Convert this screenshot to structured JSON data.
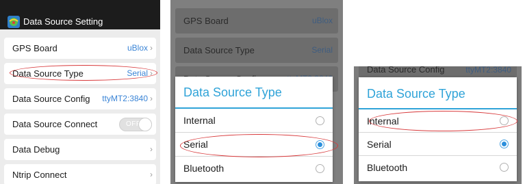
{
  "app": {
    "title": "Data Source Setting"
  },
  "settings": {
    "rows": [
      {
        "label": "GPS Board",
        "value": "uBlox"
      },
      {
        "label": "Data Source Type",
        "value": "Serial"
      },
      {
        "label": "Data Source Config",
        "value": "ttyMT2:3840"
      },
      {
        "label": "Data Source Connect",
        "toggle_text": "OFF"
      },
      {
        "label": "Data Debug"
      },
      {
        "label": "Ntrip Connect"
      }
    ]
  },
  "background_rows": {
    "gps_board": {
      "label": "GPS Board",
      "value": "uBlox"
    },
    "source_type": {
      "label": "Data Source Type",
      "value": "Serial"
    },
    "source_config_partial": {
      "label": "Data Source Config",
      "value": "ttyMT2:3840"
    }
  },
  "dialog": {
    "title": "Data Source Type",
    "options": [
      {
        "label": "Internal"
      },
      {
        "label": "Serial"
      },
      {
        "label": "Bluetooth"
      }
    ],
    "selected_index": 1
  },
  "colors": {
    "accent": "#2fa3d8",
    "value_blue": "#3a84d6",
    "annotation_red": "#d8393b",
    "titlebar": "#1c1c1c"
  },
  "icons": {
    "chevron": "›",
    "app_icon": "gps-app-icon"
  }
}
